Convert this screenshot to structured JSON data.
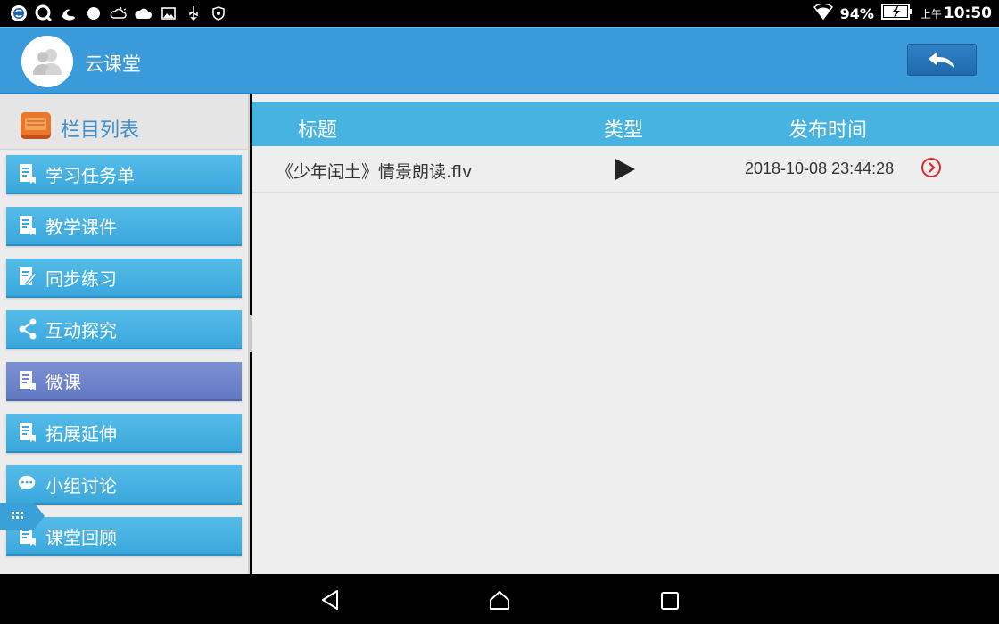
{
  "status_bar": {
    "left_icons": [
      "sogou-icon",
      "qq-browser-icon",
      "uc-icon",
      "dot-icon",
      "weather-icon",
      "cloud-icon",
      "image-icon",
      "usb-icon",
      "shield-icon"
    ],
    "battery_percent": "94%",
    "time_prefix": "上午",
    "time": "10:50"
  },
  "header": {
    "title": "云课堂"
  },
  "sidebar": {
    "title": "栏目列表",
    "items": [
      {
        "label": "学习任务单",
        "icon": "document-icon",
        "active": false
      },
      {
        "label": "教学课件",
        "icon": "document-icon",
        "active": false
      },
      {
        "label": "同步练习",
        "icon": "edit-document-icon",
        "active": false
      },
      {
        "label": "互动探究",
        "icon": "share-icon",
        "active": false
      },
      {
        "label": "微课",
        "icon": "document-icon",
        "active": true
      },
      {
        "label": "拓展延伸",
        "icon": "document-icon",
        "active": false
      },
      {
        "label": "小组讨论",
        "icon": "chat-icon",
        "active": false
      },
      {
        "label": "课堂回顾",
        "icon": "document-icon",
        "active": false
      }
    ]
  },
  "table": {
    "columns": [
      "标题",
      "类型",
      "发布时间"
    ],
    "rows": [
      {
        "title": "《少年闰土》情景朗读.flv",
        "type": "video-play-icon",
        "time": "2018-10-08 23:44:28"
      }
    ]
  },
  "colors": {
    "header_bg": "#3b9ad9",
    "menu_item": "#45b0e0",
    "menu_active": "#6f84cb",
    "table_header": "#46b3e0",
    "arrow_red": "#e0262a"
  }
}
